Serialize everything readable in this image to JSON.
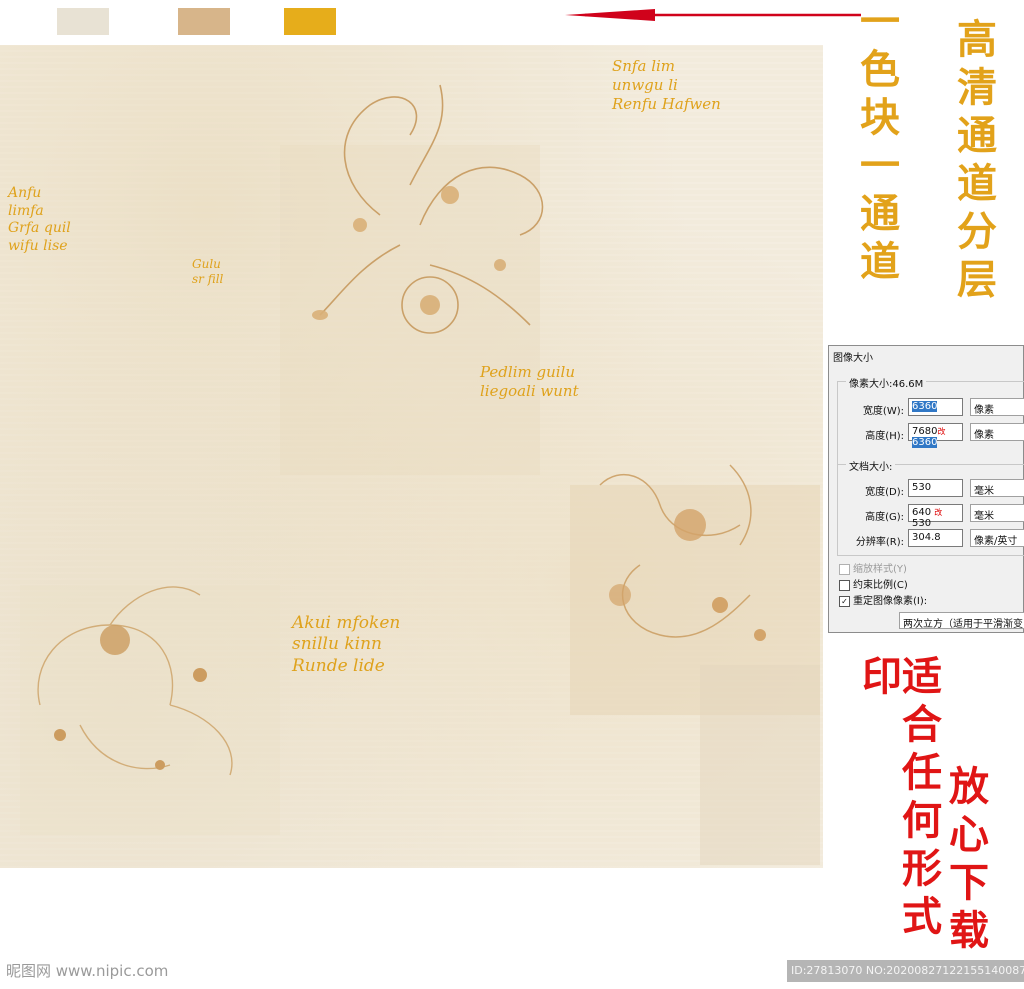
{
  "swatches": [
    {
      "name": "cream",
      "color": "#e8e2d4"
    },
    {
      "name": "tan",
      "color": "#d7b58a"
    },
    {
      "name": "gold",
      "color": "#e6ad1b"
    }
  ],
  "arrow_color": "#d0021b",
  "side_text": {
    "channel_note": "一色块一通道",
    "hd_note": "高清通道分层",
    "print_note": "适合任何形式印",
    "download_note": "放心下载"
  },
  "wallpaper": {
    "script_texts": [
      "Snfa lim\nunwgu li\nRenfu Hafwen",
      "Anfu\nlimfa\nGrfa quil\nwifu lise",
      "Gulu\nsr fill",
      "Pedlim guilu\nliegoali wunt",
      "Akui mfoken\nsnillu kinn\nRunde lide"
    ]
  },
  "dialog": {
    "title": "图像大小",
    "pixel_size_label": "像素大小:46.6M",
    "pixel_width": {
      "label": "宽度(W):",
      "value": "6360",
      "unit": "像素"
    },
    "pixel_height": {
      "label": "高度(H):",
      "value_old": "7680",
      "change_mark": "改",
      "value_new": "6360",
      "unit": "像素"
    },
    "doc_size_label": "文档大小:",
    "doc_width": {
      "label": "宽度(D):",
      "value": "530",
      "unit": "毫米"
    },
    "doc_height": {
      "label": "高度(G):",
      "value_old": "640",
      "change_mark": "改",
      "value_new": "530",
      "unit": "毫米"
    },
    "resolution": {
      "label": "分辨率(R):",
      "value": "304.8",
      "unit": "像素/英寸"
    },
    "scale_styles": "缩放样式(Y)",
    "constrain": "约束比例(C)",
    "resample": "重定图像像素(I):",
    "resample_method": "两次立方（适用于平滑渐变"
  },
  "watermark": {
    "site": "昵图网 www.nipic.com",
    "id_text": "ID:27813070 NO:20200827122155140087"
  }
}
